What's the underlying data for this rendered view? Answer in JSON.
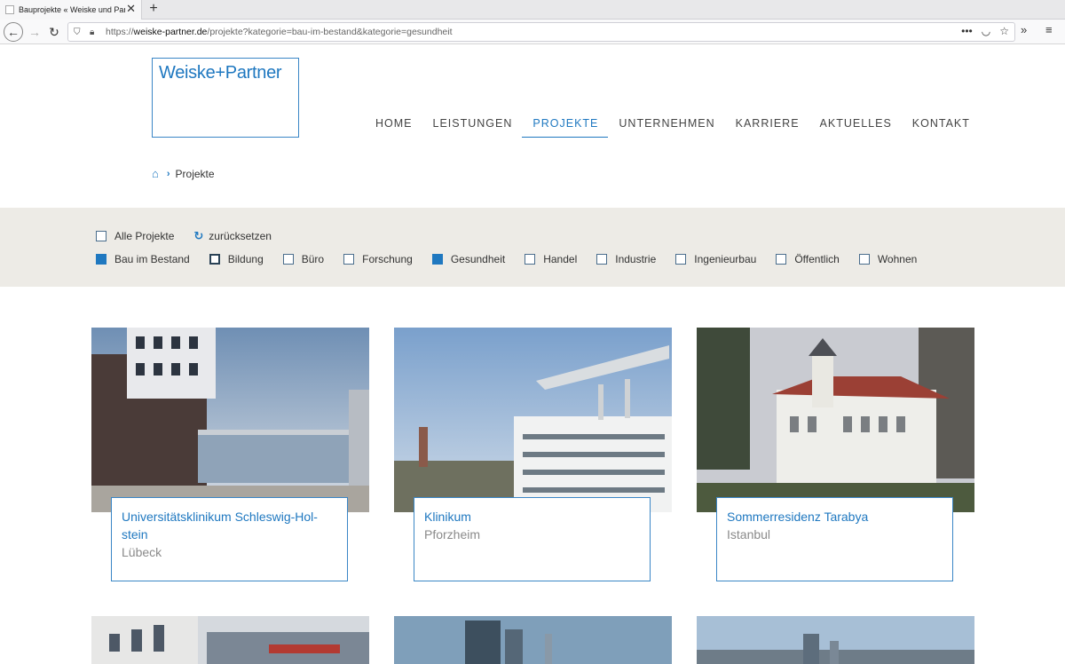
{
  "browser": {
    "tab_title": "Bauprojekte « Weiske und Partner",
    "url_prefix": "https://",
    "url_domain": "weiske-partner.de",
    "url_path": "/projekte?kategorie=bau-im-bestand&kategorie=gesundheit"
  },
  "site": {
    "logo_text": "Weiske+Partner",
    "nav": [
      {
        "label": "HOME"
      },
      {
        "label": "LEISTUNGEN"
      },
      {
        "label": "PROJEKTE",
        "active": true
      },
      {
        "label": "UNTERNEHMEN"
      },
      {
        "label": "KARRIERE"
      },
      {
        "label": "AKTUELLES"
      },
      {
        "label": "KONTAKT"
      }
    ],
    "breadcrumb_current": "Projekte"
  },
  "filters": {
    "all_label": "Alle Projekte",
    "reset_label": "zurücksetzen",
    "categories": [
      {
        "label": "Bau im Bestand",
        "checked": true
      },
      {
        "label": "Bildung",
        "checked": false
      },
      {
        "label": "Büro",
        "checked": false
      },
      {
        "label": "Forschung",
        "checked": false
      },
      {
        "label": "Gesundheit",
        "checked": true
      },
      {
        "label": "Handel",
        "checked": false
      },
      {
        "label": "Industrie",
        "checked": false
      },
      {
        "label": "Ingenieurbau",
        "checked": false
      },
      {
        "label": "Öffentlich",
        "checked": false
      },
      {
        "label": "Wohnen",
        "checked": false
      }
    ]
  },
  "projects": [
    {
      "title": "Universitätsklinikum Schleswig-Hol-stein",
      "location": "Lübeck"
    },
    {
      "title": "Klinikum",
      "location": "Pforzheim"
    },
    {
      "title": "Sommerresidenz Tarabya",
      "location": "Istanbul"
    }
  ],
  "colors": {
    "accent": "#1f78c0",
    "filter_bg": "#edebe6"
  }
}
